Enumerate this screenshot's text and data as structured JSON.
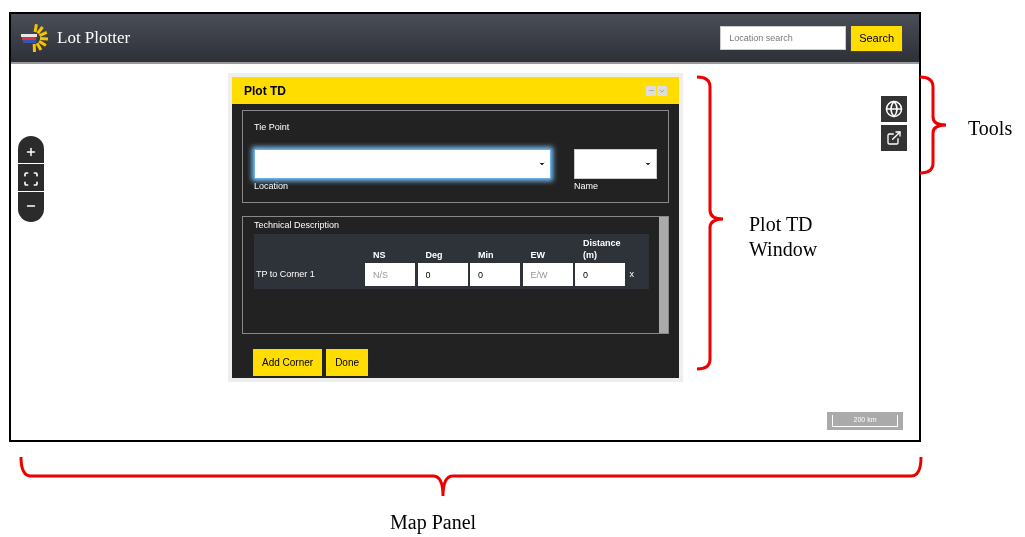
{
  "app": {
    "title": "Lot Plotter",
    "search": {
      "placeholder": "Location search",
      "button": "Search"
    }
  },
  "map": {
    "scale": "200 km"
  },
  "window": {
    "title": "Plot TD",
    "tie_point": {
      "legend": "Tie Point",
      "fields": [
        {
          "label": "Location",
          "focused": true
        },
        {
          "label": "Name",
          "focused": false
        }
      ]
    },
    "technical_description": {
      "legend": "Technical Description",
      "columns": [
        "NS",
        "Deg",
        "Min",
        "EW",
        "Distance (m)"
      ],
      "rows": [
        {
          "label": "TP to Corner 1",
          "cells": [
            {
              "placeholder": "N/S"
            },
            {
              "value": "0"
            },
            {
              "value": "0"
            },
            {
              "placeholder": "E/W"
            },
            {
              "value": "0"
            }
          ],
          "remove": "x"
        }
      ]
    },
    "buttons": [
      "Add Corner",
      "Done"
    ]
  },
  "annotations": [
    {
      "kind": "tools",
      "label": "Tools"
    },
    {
      "kind": "window",
      "label": "Plot TD Window"
    },
    {
      "kind": "map",
      "label": "Map Panel"
    }
  ]
}
